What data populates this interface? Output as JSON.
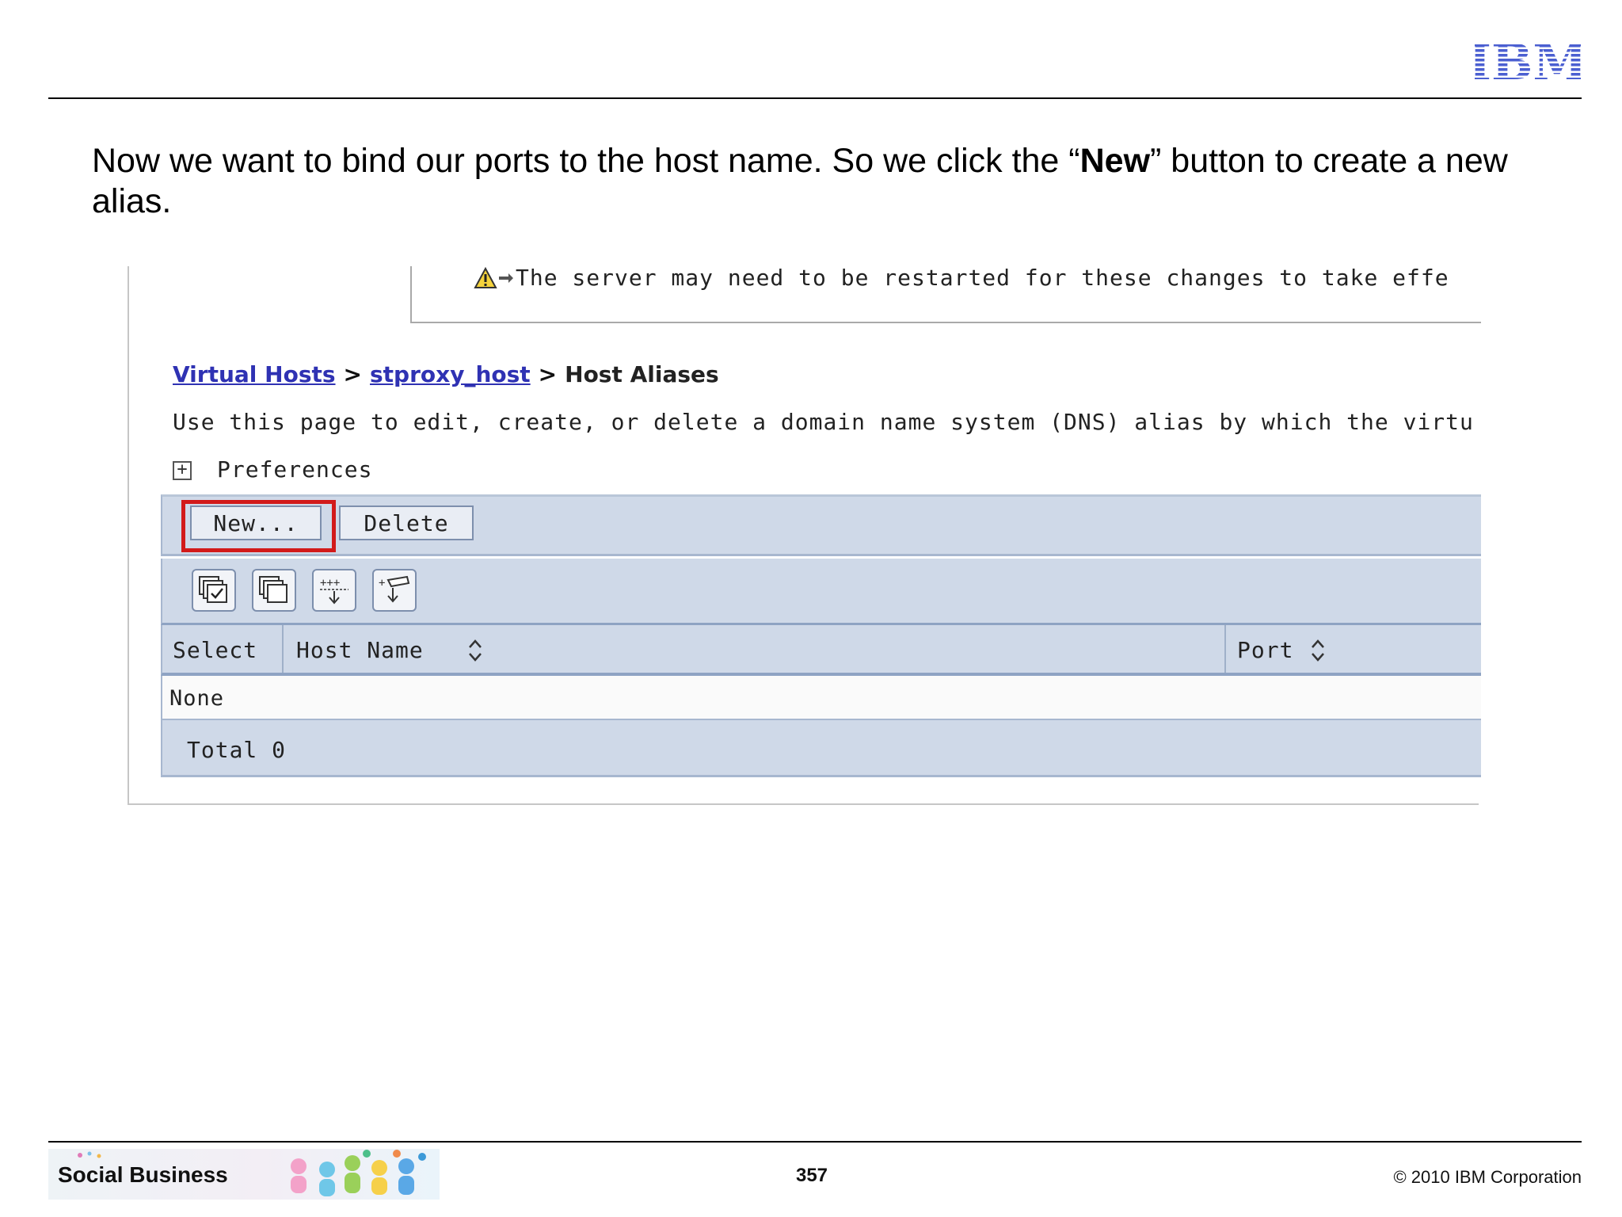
{
  "slide": {
    "logo_text": "IBM",
    "heading_part1": "Now we want to bind our ports to the host name. So we click the “",
    "heading_bold": "New",
    "heading_part2": "” button to create a new alias."
  },
  "console": {
    "warning_message": "The server may need to be restarted for these changes to take effe",
    "breadcrumb": {
      "link1": "Virtual Hosts",
      "sep1": ">",
      "link2": "stproxy_host",
      "sep2": ">",
      "current": "Host Aliases"
    },
    "description": "Use this page to edit, create, or delete a domain name system (DNS) alias by which the virtu",
    "preferences": {
      "toggle_symbol": "+",
      "label": "Preferences"
    },
    "buttons": {
      "new_label": "New...",
      "delete_label": "Delete"
    },
    "toolbar_icons": [
      "select-all-icon",
      "deselect-all-icon",
      "show-filter-icon",
      "clear-filter-icon"
    ],
    "table": {
      "columns": [
        "Select",
        "Host Name",
        "Port"
      ],
      "empty_text": "None",
      "total_label": "Total 0"
    },
    "colors": {
      "link": "#2f32b3",
      "table_band": "#cfd9e8",
      "highlight": "#d21a1a"
    }
  },
  "footer": {
    "brand": "Social Business",
    "page_number": "357",
    "copyright": "© 2010 IBM Corporation"
  }
}
